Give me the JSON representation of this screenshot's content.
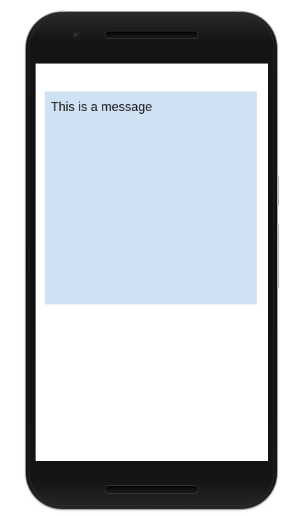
{
  "device": {
    "type": "android-phone-frame",
    "body_color": "#111111"
  },
  "screen": {
    "background_color": "#ffffff",
    "message": {
      "text": "This is a message",
      "background_color": "#cfe2f3",
      "text_color": "#111111"
    }
  },
  "icons": {
    "camera": "front-camera-icon",
    "top_speaker": "earpiece-speaker-icon",
    "bottom_speaker": "bottom-speaker-icon"
  }
}
